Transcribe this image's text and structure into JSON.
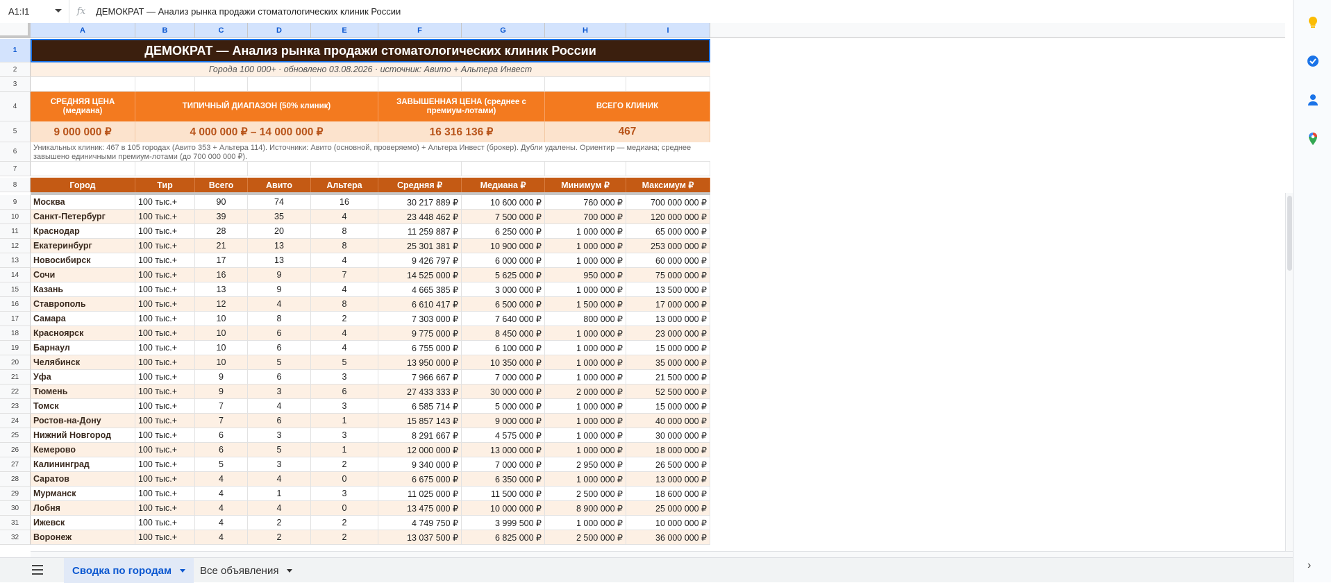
{
  "formula_bar": {
    "cell_ref": "A1:I1",
    "fx": "fx",
    "content": "ДЕМОКРАТ — Анализ рынка продажи стоматологических клиник России"
  },
  "columns": [
    "A",
    "B",
    "C",
    "D",
    "E",
    "F",
    "G",
    "H",
    "I"
  ],
  "row_numbers": [
    "1",
    "2",
    "3",
    "4",
    "5",
    "6",
    "7",
    "8",
    "9",
    "10",
    "11",
    "12",
    "13",
    "14",
    "15",
    "16",
    "17",
    "18",
    "19",
    "20",
    "21",
    "22",
    "23",
    "24",
    "25",
    "26",
    "27",
    "28",
    "29",
    "30",
    "31",
    "32"
  ],
  "sheet": {
    "title": "ДЕМОКРАТ — Анализ рынка продажи стоматологических клиник России",
    "subtitle": "Города 100 000+ · обновлено 03.08.2026 · источник: Авито + Альтера Инвест",
    "kpis": [
      {
        "label": "СРЕДНЯЯ ЦЕНА (медиана)",
        "value": "9 000 000 ₽"
      },
      {
        "label": "ТИПИЧНЫЙ ДИАПАЗОН (50% клиник)",
        "value": "4 000 000 ₽ – 14 000 000 ₽"
      },
      {
        "label": "ЗАВЫШЕННАЯ ЦЕНА (среднее с премиум-лотами)",
        "value": "16 316 136 ₽"
      },
      {
        "label": "ВСЕГО КЛИНИК",
        "value": "467"
      }
    ],
    "note": "Уникальных клиник: 467 в 105 городах (Авито 353 + Альтера 114). Источники: Авито (основной, проверяемо) + Альтера Инвест (брокер). Дубли удалены. Ориентир — медиана; среднее завышено единичными премиум-лотами (до 700 000 000 ₽).",
    "headers": [
      "Город",
      "Тир",
      "Всего",
      "Авито",
      "Альтера",
      "Средняя ₽",
      "Медиана ₽",
      "Минимум ₽",
      "Максимум ₽"
    ],
    "rows": [
      [
        "Москва",
        "100 тыс.+",
        "90",
        "74",
        "16",
        "30 217 889 ₽",
        "10 600 000 ₽",
        "760 000 ₽",
        "700 000 000 ₽"
      ],
      [
        "Санкт-Петербург",
        "100 тыс.+",
        "39",
        "35",
        "4",
        "23 448 462 ₽",
        "7 500 000 ₽",
        "700 000 ₽",
        "120 000 000 ₽"
      ],
      [
        "Краснодар",
        "100 тыс.+",
        "28",
        "20",
        "8",
        "11 259 887 ₽",
        "6 250 000 ₽",
        "1 000 000 ₽",
        "65 000 000 ₽"
      ],
      [
        "Екатеринбург",
        "100 тыс.+",
        "21",
        "13",
        "8",
        "25 301 381 ₽",
        "10 900 000 ₽",
        "1 000 000 ₽",
        "253 000 000 ₽"
      ],
      [
        "Новосибирск",
        "100 тыс.+",
        "17",
        "13",
        "4",
        "9 426 797 ₽",
        "6 000 000 ₽",
        "1 000 000 ₽",
        "60 000 000 ₽"
      ],
      [
        "Сочи",
        "100 тыс.+",
        "16",
        "9",
        "7",
        "14 525 000 ₽",
        "5 625 000 ₽",
        "950 000 ₽",
        "75 000 000 ₽"
      ],
      [
        "Казань",
        "100 тыс.+",
        "13",
        "9",
        "4",
        "4 665 385 ₽",
        "3 000 000 ₽",
        "1 000 000 ₽",
        "13 500 000 ₽"
      ],
      [
        "Ставрополь",
        "100 тыс.+",
        "12",
        "4",
        "8",
        "6 610 417 ₽",
        "6 500 000 ₽",
        "1 500 000 ₽",
        "17 000 000 ₽"
      ],
      [
        "Самара",
        "100 тыс.+",
        "10",
        "8",
        "2",
        "7 303 000 ₽",
        "7 640 000 ₽",
        "800 000 ₽",
        "13 000 000 ₽"
      ],
      [
        "Красноярск",
        "100 тыс.+",
        "10",
        "6",
        "4",
        "9 775 000 ₽",
        "8 450 000 ₽",
        "1 000 000 ₽",
        "23 000 000 ₽"
      ],
      [
        "Барнаул",
        "100 тыс.+",
        "10",
        "6",
        "4",
        "6 755 000 ₽",
        "6 100 000 ₽",
        "1 000 000 ₽",
        "15 000 000 ₽"
      ],
      [
        "Челябинск",
        "100 тыс.+",
        "10",
        "5",
        "5",
        "13 950 000 ₽",
        "10 350 000 ₽",
        "1 000 000 ₽",
        "35 000 000 ₽"
      ],
      [
        "Уфа",
        "100 тыс.+",
        "9",
        "6",
        "3",
        "7 966 667 ₽",
        "7 000 000 ₽",
        "1 000 000 ₽",
        "21 500 000 ₽"
      ],
      [
        "Тюмень",
        "100 тыс.+",
        "9",
        "3",
        "6",
        "27 433 333 ₽",
        "30 000 000 ₽",
        "2 000 000 ₽",
        "52 500 000 ₽"
      ],
      [
        "Томск",
        "100 тыс.+",
        "7",
        "4",
        "3",
        "6 585 714 ₽",
        "5 000 000 ₽",
        "1 000 000 ₽",
        "15 000 000 ₽"
      ],
      [
        "Ростов-на-Дону",
        "100 тыс.+",
        "7",
        "6",
        "1",
        "15 857 143 ₽",
        "9 000 000 ₽",
        "1 000 000 ₽",
        "40 000 000 ₽"
      ],
      [
        "Нижний Новгород",
        "100 тыс.+",
        "6",
        "3",
        "3",
        "8 291 667 ₽",
        "4 575 000 ₽",
        "1 000 000 ₽",
        "30 000 000 ₽"
      ],
      [
        "Кемерово",
        "100 тыс.+",
        "6",
        "5",
        "1",
        "12 000 000 ₽",
        "13 000 000 ₽",
        "1 000 000 ₽",
        "18 000 000 ₽"
      ],
      [
        "Калининград",
        "100 тыс.+",
        "5",
        "3",
        "2",
        "9 340 000 ₽",
        "7 000 000 ₽",
        "2 950 000 ₽",
        "26 500 000 ₽"
      ],
      [
        "Саратов",
        "100 тыс.+",
        "4",
        "4",
        "0",
        "6 675 000 ₽",
        "6 350 000 ₽",
        "1 000 000 ₽",
        "13 000 000 ₽"
      ],
      [
        "Мурманск",
        "100 тыс.+",
        "4",
        "1",
        "3",
        "11 025 000 ₽",
        "11 500 000 ₽",
        "2 500 000 ₽",
        "18 600 000 ₽"
      ],
      [
        "Лобня",
        "100 тыс.+",
        "4",
        "4",
        "0",
        "13 475 000 ₽",
        "10 000 000 ₽",
        "8 900 000 ₽",
        "25 000 000 ₽"
      ],
      [
        "Ижевск",
        "100 тыс.+",
        "4",
        "2",
        "2",
        "4 749 750 ₽",
        "3 999 500 ₽",
        "1 000 000 ₽",
        "10 000 000 ₽"
      ],
      [
        "Воронеж",
        "100 тыс.+",
        "4",
        "2",
        "2",
        "13 037 500 ₽",
        "6 825 000 ₽",
        "2 500 000 ₽",
        "36 000 000 ₽"
      ]
    ]
  },
  "tabs": [
    {
      "label": "Сводка по городам",
      "active": true
    },
    {
      "label": "Все объявления",
      "active": false
    }
  ],
  "side_panel": [
    "keep-icon",
    "tasks-icon",
    "contacts-icon",
    "maps-icon"
  ],
  "colors": {
    "title_bg": "#3b1f0e",
    "kpi_bg": "#f37a1f",
    "kpi_value_bg": "#fce3cd",
    "header_bg": "#c45a14",
    "stripe": "#fdf0e4",
    "accent": "#0b57d0"
  }
}
